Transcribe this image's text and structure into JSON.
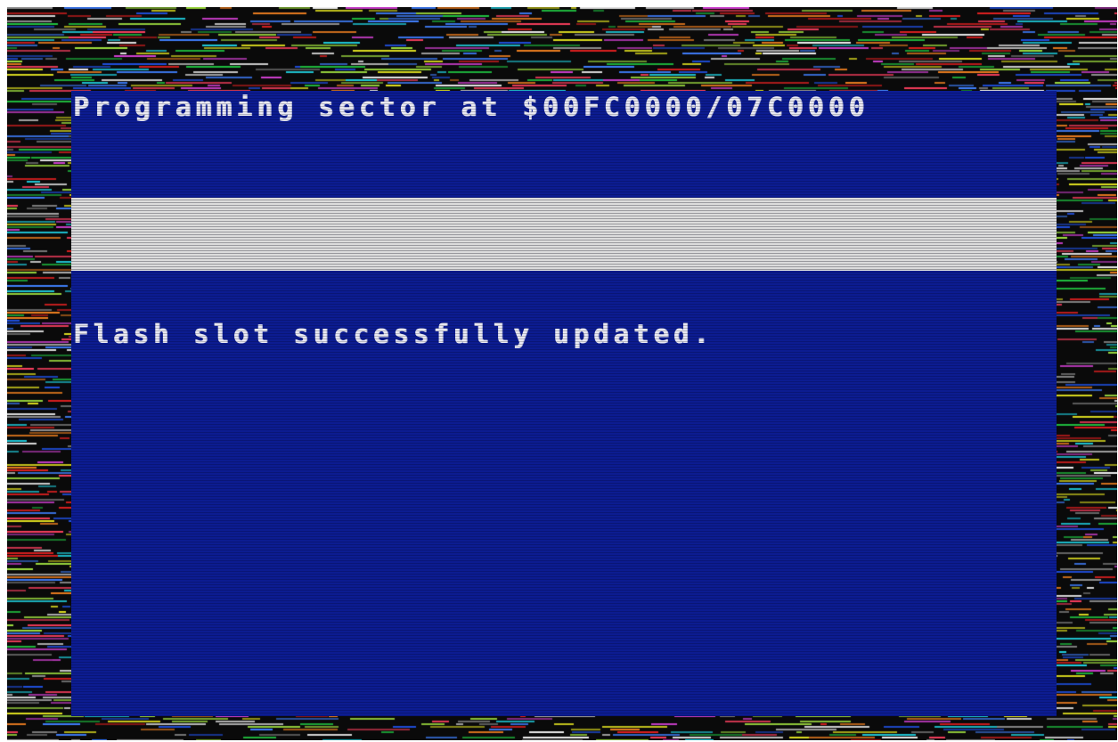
{
  "screen": {
    "status_text": "Programming sector at $00FC0000/07C0000",
    "message_text": "Flash slot successfully updated.",
    "progress": 1.0
  },
  "colors": {
    "screen_background": "#0c1c91",
    "text": "#e9e9f2",
    "progress_bar": "#d8d8d8",
    "border_base": "#0a0a0a"
  },
  "icons": []
}
